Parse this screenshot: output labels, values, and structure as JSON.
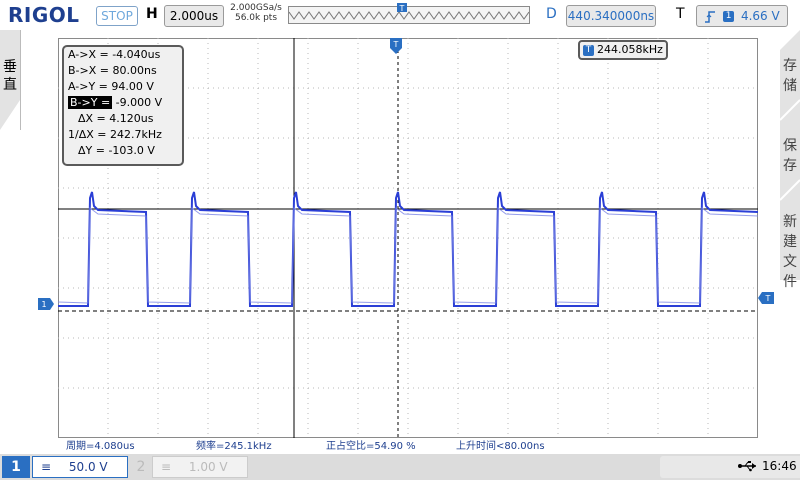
{
  "brand": "RIGOL",
  "run_state": "STOP",
  "horizontal": {
    "label": "H",
    "timebase": "2.000us",
    "sample_rate": "2.000GSa/s",
    "points": "56.0k pts"
  },
  "delay": {
    "label": "D",
    "value": "440.340000ns"
  },
  "trigger": {
    "label": "T",
    "slope_icon": "rising-edge-icon",
    "channel": "1",
    "level": "4.66 V"
  },
  "left_tab": {
    "label": "垂直"
  },
  "right_menu": {
    "items": [
      "存储",
      "保存",
      "新建文件"
    ]
  },
  "cursor": {
    "rows": [
      "A->X = -4.040us",
      "B->X = 80.00ns",
      "A->Y = 94.00 V",
      "B->Y =",
      " -9.000 V",
      "ΔX = 4.120us",
      "1/ΔX = 242.7kHz",
      "ΔY = -103.0 V"
    ]
  },
  "trigger_freq": {
    "badge": "T",
    "value": "244.058kHz"
  },
  "measurements": {
    "period": "周期=4.080us",
    "frequency": "频率=245.1kHz",
    "duty": "正占空比=54.90 %",
    "rise_time": "上升时间<80.00ns"
  },
  "channels": [
    {
      "num": "1",
      "coupling": "≡",
      "scale": "50.0 V",
      "active": true
    },
    {
      "num": "2",
      "coupling": "≡",
      "scale": "1.00 V",
      "active": false
    }
  ],
  "status": {
    "usb_icon": "usb-icon",
    "time": "16:46"
  },
  "colors": {
    "accent": "#2a6fc2",
    "trace": "#2b3fd6"
  }
}
